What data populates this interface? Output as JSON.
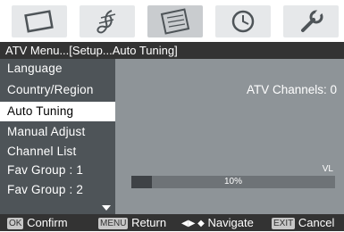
{
  "topbar": {
    "icons": [
      "picture-icon",
      "audio-icon",
      "channel-icon",
      "time-icon",
      "setup-icon"
    ]
  },
  "breadcrumb": "ATV Menu...[Setup...Auto Tuning]",
  "menu": {
    "items": [
      {
        "label": "Language"
      },
      {
        "label": "Country/Region"
      },
      {
        "label": "Auto Tuning"
      },
      {
        "label": "Manual Adjust"
      },
      {
        "label": "Channel List"
      },
      {
        "label": "Fav Group : 1"
      },
      {
        "label": "Fav Group : 2"
      }
    ],
    "selected": "Auto Tuning"
  },
  "content": {
    "atv_channels": "ATV Channels: 0",
    "band_label": "VL",
    "progress": 0.1,
    "progress_text": "10%"
  },
  "help": {
    "confirm_key": "OK",
    "confirm_label": "Confirm",
    "return_key": "MENU",
    "return_label": "Return",
    "navigate_label": "Navigate",
    "cancel_key": "EXIT",
    "cancel_label": "Cancel"
  },
  "colors": {
    "menu_bg": "#4e5458",
    "content_bg": "#8e9498",
    "bar_bg": "#333333",
    "selected_bg": "#ffffff"
  }
}
